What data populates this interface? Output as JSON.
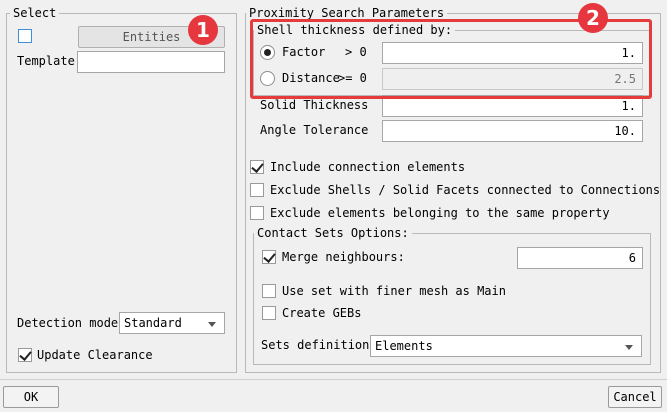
{
  "select_group": {
    "title": "Select",
    "entities_button": "Entities",
    "entities_checked": false,
    "template_label": "Template",
    "template_value": "",
    "detection_mode_label": "Detection mode",
    "detection_mode_value": "Standard",
    "update_clearance_label": "Update Clearance",
    "update_clearance_checked": true
  },
  "proximity_group": {
    "title": "Proximity Search Parameters",
    "shell_thickness_title": "Shell thickness defined by:",
    "factor_label": "Factor",
    "factor_condition": "> 0",
    "factor_value": "1.",
    "factor_selected": true,
    "distance_label": "Distance",
    "distance_condition": ">= 0",
    "distance_value": "2.5",
    "distance_selected": false,
    "solid_thickness_label": "Solid Thickness",
    "solid_thickness_value": "1.",
    "angle_tolerance_label": "Angle Tolerance",
    "angle_tolerance_value": "10.",
    "include_connection_label": "Include connection elements",
    "include_connection_checked": true,
    "exclude_shells_label": "Exclude Shells / Solid Facets connected to Connections",
    "exclude_shells_checked": false,
    "exclude_same_property_label": "Exclude elements belonging to the same property",
    "exclude_same_property_checked": false
  },
  "contact_sets": {
    "title": "Contact Sets Options:",
    "merge_neighbours_label": "Merge neighbours:",
    "merge_neighbours_checked": true,
    "merge_neighbours_value": "6",
    "finer_mesh_label": "Use set with finer mesh as Main",
    "finer_mesh_checked": false,
    "create_gebs_label": "Create GEBs",
    "create_gebs_checked": false,
    "sets_definition_label": "Sets definition",
    "sets_definition_value": "Elements"
  },
  "footer": {
    "ok_label": "OK",
    "cancel_label": "Cancel"
  },
  "annotations": {
    "badge_1": "1",
    "badge_2": "2",
    "color": "#e53b3b"
  }
}
